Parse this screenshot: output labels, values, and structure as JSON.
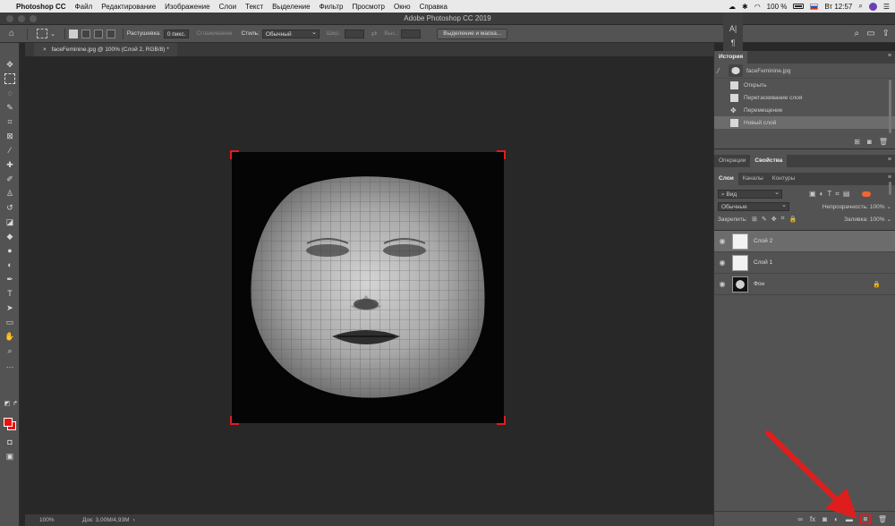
{
  "menubar": {
    "app_name": "Photoshop CC",
    "items": [
      "Файл",
      "Редактирование",
      "Изображение",
      "Слои",
      "Текст",
      "Выделение",
      "Фильтр",
      "Просмотр",
      "Окно",
      "Справка"
    ],
    "battery": "100 %",
    "clock": "Вт 12:57"
  },
  "window": {
    "title": "Adobe Photoshop CC 2019"
  },
  "options": {
    "feather_label": "Растушевка:",
    "feather_value": "0 пикс.",
    "antialias_label": "Сглаживание",
    "style_label": "Стиль:",
    "style_value": "Обычный",
    "width_label": "Шир.:",
    "height_label": "Выс.:",
    "mask_button": "Выделение и маска..."
  },
  "document": {
    "tab_title": "faceFeminine.jpg @ 100% (Слой 2, RGB/8) *"
  },
  "status": {
    "zoom": "100%",
    "doc_info": "Док: 3,00M/4,93M"
  },
  "history": {
    "panel_title": "История",
    "snapshot_name": "faceFeminine.jpg",
    "items": [
      "Открыть",
      "Перетаскивание слоя",
      "Перемещение",
      "Новый слой"
    ]
  },
  "props_panel": {
    "tab_operations": "Операции",
    "tab_properties": "Свойства"
  },
  "layers_panel": {
    "tab_layers": "Слои",
    "tab_channels": "Каналы",
    "tab_paths": "Контуры",
    "filter_kind": "Вид",
    "blend_mode": "Обычные",
    "opacity_label": "Непрозрачность:",
    "opacity_value": "100%",
    "lock_label": "Закрепить:",
    "fill_label": "Заливка:",
    "fill_value": "100%",
    "layers": [
      {
        "name": "Слой 2"
      },
      {
        "name": "Слой 1"
      },
      {
        "name": "Фон"
      }
    ]
  },
  "colors": {
    "accent_red": "#e01d1d",
    "foreground": "#e11111",
    "background": "#e11111"
  }
}
